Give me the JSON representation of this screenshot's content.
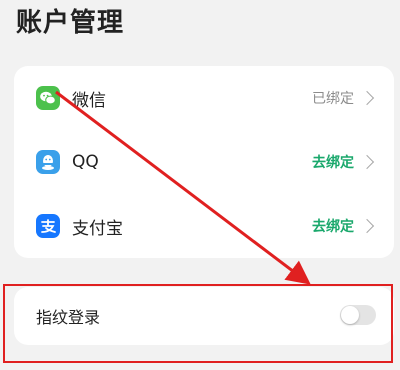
{
  "page": {
    "title": "账户管理"
  },
  "accounts": [
    {
      "name": "微信",
      "status": "已绑定"
    },
    {
      "name": "QQ",
      "status": "去绑定"
    },
    {
      "name": "支付宝",
      "status": "去绑定"
    }
  ],
  "fingerprint": {
    "label": "指纹登录",
    "enabled": false
  },
  "colors": {
    "accent_green": "#1aa86c",
    "annotation_red": "#e02020",
    "wechat": "#4cc14c",
    "qq": "#3aa0ea",
    "alipay": "#1677ff"
  },
  "icons": [
    "wechat-icon",
    "qq-icon",
    "alipay-icon",
    "chevron-right-icon",
    "toggle-switch"
  ]
}
